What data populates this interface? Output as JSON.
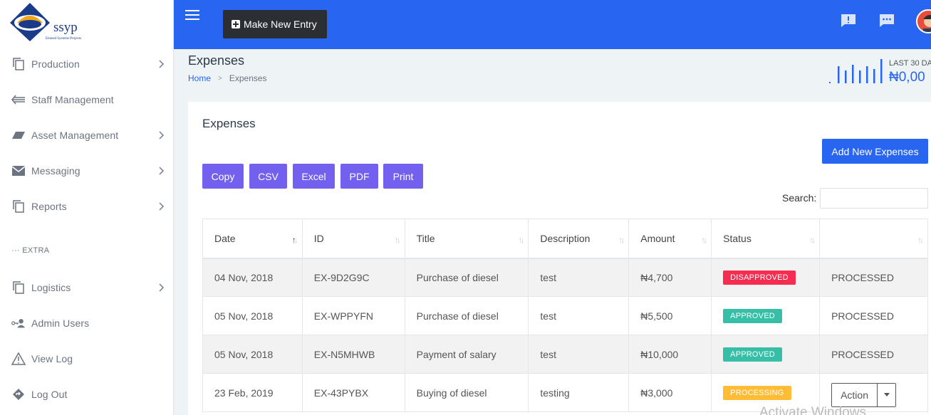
{
  "logo": {
    "name": "ssyp",
    "tagline": "Ennead Systems Projects"
  },
  "sidebar": {
    "items": [
      {
        "label": "Production",
        "icon": "copy-icon",
        "chevron": true
      },
      {
        "label": "Staff Management",
        "icon": "arrow-list-icon",
        "chevron": false
      },
      {
        "label": "Asset Management",
        "icon": "parallelogram-icon",
        "chevron": true
      },
      {
        "label": "Messaging",
        "icon": "envelope-icon",
        "chevron": true
      },
      {
        "label": "Reports",
        "icon": "copy-icon",
        "chevron": true
      }
    ],
    "extra_label": "··· EXTRA",
    "extra_items": [
      {
        "label": "Logistics",
        "icon": "copy-icon",
        "chevron": true
      },
      {
        "label": "Admin Users",
        "icon": "user-key-icon",
        "chevron": false
      },
      {
        "label": "View Log",
        "icon": "warning-icon",
        "chevron": false
      },
      {
        "label": "Log Out",
        "icon": "diamond-arrow-icon",
        "chevron": false
      }
    ]
  },
  "topbar": {
    "make_entry_label": "Make New Entry",
    "icons": [
      "menu-icon",
      "alert-chat-icon",
      "message-icon",
      "avatar"
    ]
  },
  "header": {
    "title": "Expenses",
    "breadcrumb": {
      "home": "Home",
      "current": "Expenses"
    },
    "stats": {
      "label": "LAST 30 DA",
      "value": "₦0,00"
    }
  },
  "card": {
    "title": "Expenses",
    "add_button": "Add New Expenses",
    "export_buttons": [
      "Copy",
      "CSV",
      "Excel",
      "PDF",
      "Print"
    ],
    "search_label": "Search:",
    "search_value": ""
  },
  "table": {
    "columns": [
      "Date",
      "ID",
      "Title",
      "Description",
      "Amount",
      "Status",
      ""
    ],
    "rows": [
      {
        "date": "04 Nov, 2018",
        "id": "EX-9D2G9C",
        "title": "Purchase of diesel",
        "description": "test",
        "amount": "₦4,700",
        "status": "DISAPPROVED",
        "status_color": "#f62d51",
        "action": "PROCESSED"
      },
      {
        "date": "05 Nov, 2018",
        "id": "EX-WPPYFN",
        "title": "Purchase of diesel",
        "description": "test",
        "amount": "₦5,500",
        "status": "APPROVED",
        "status_color": "#36bea6",
        "action": "PROCESSED"
      },
      {
        "date": "05 Nov, 2018",
        "id": "EX-N5MHWB",
        "title": "Payment of salary",
        "description": "test",
        "amount": "₦10,000",
        "status": "APPROVED",
        "status_color": "#36bea6",
        "action": "PROCESSED"
      },
      {
        "date": "23 Feb, 2019",
        "id": "EX-43PYBX",
        "title": "Buying of diesel",
        "description": "testing",
        "amount": "₦3,000",
        "status": "PROCESSING",
        "status_color": "#ffbc34",
        "action": "Action"
      }
    ]
  },
  "watermark": "Activate Windows",
  "colors": {
    "primary": "#2865f0",
    "export": "#7460ee",
    "dark": "#2b2f33"
  }
}
